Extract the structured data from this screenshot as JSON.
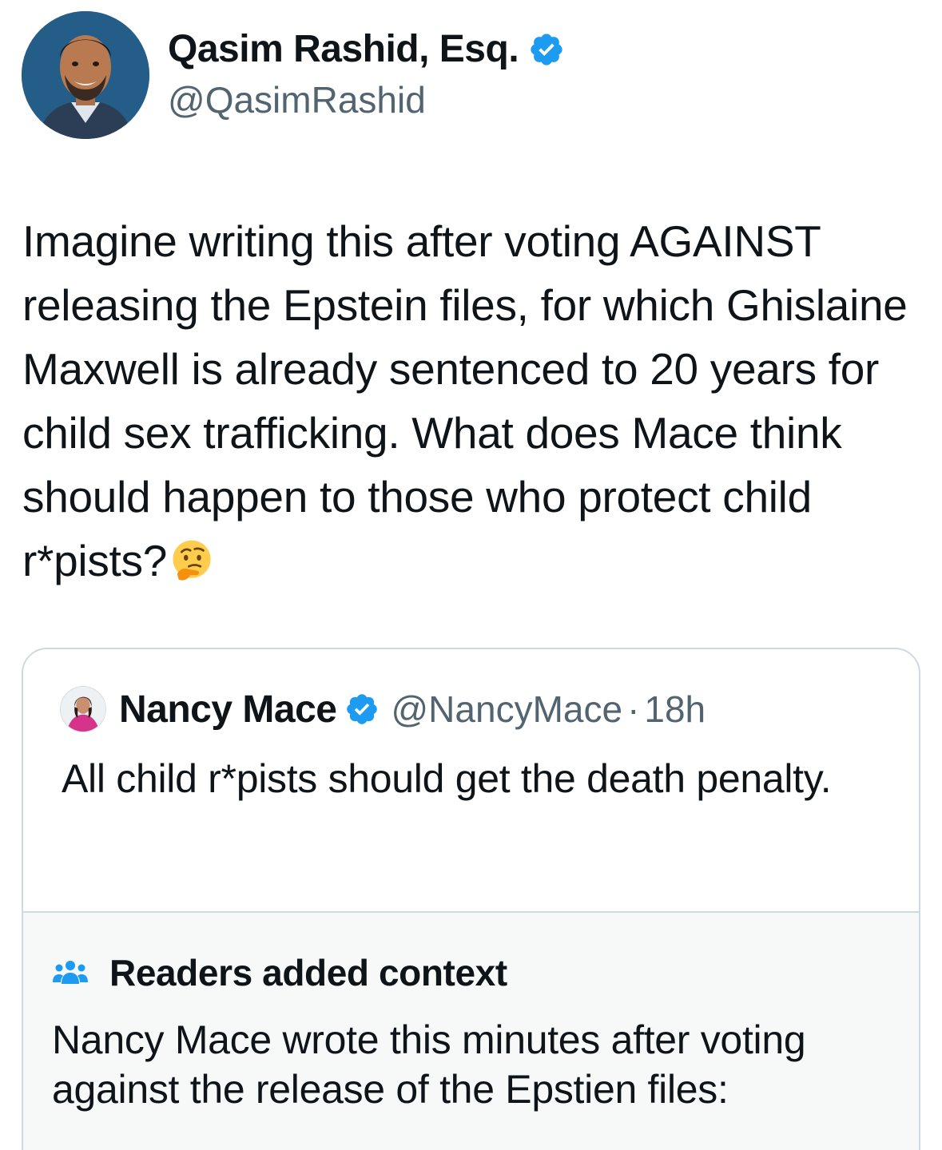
{
  "tweet": {
    "author": {
      "name": "Qasim Rashid, Esq.",
      "handle": "@QasimRashid",
      "verified": true
    },
    "text": "Imagine writing this after voting AGAINST releasing the Epstein files, for which Ghislaine Maxwell is already sentenced to 20 years for child sex trafficking. What does Mace think should happen to those who protect child r*pists?",
    "emoji": "thinking-face"
  },
  "quote": {
    "author": {
      "name": "Nancy Mace",
      "handle": "@NancyMace",
      "verified": true,
      "time": "18h",
      "separator": "·"
    },
    "text": "All child r*pists should get the death penalty."
  },
  "context": {
    "icon": "people-icon",
    "title": "Readers added context",
    "text": "Nancy Mace wrote this minutes after voting against the release of the Epstien files:"
  },
  "colors": {
    "verified": "#1d9bf0",
    "secondary_text": "#536471",
    "border": "#cfd9de",
    "context_bg": "#f7f9f9"
  }
}
